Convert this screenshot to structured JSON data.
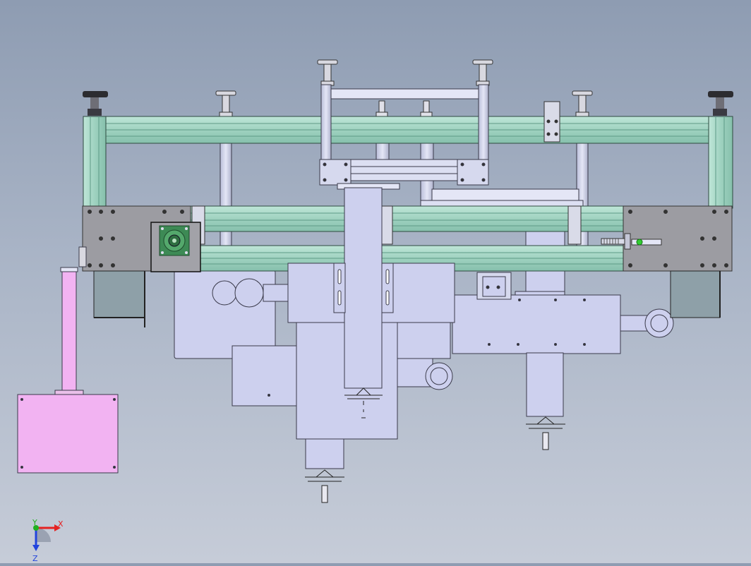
{
  "viewport": {
    "background_top": "#8e9cb2",
    "background_bottom": "#c6ccd8"
  },
  "colors": {
    "extrusion": "#a8d8c8",
    "extrusion_dark": "#6fae98",
    "steel_plate": "#9a9aa0",
    "part_fill": "#cdd0ee",
    "part_stroke": "#3a3a4a",
    "motor_block": "#8ea0a8",
    "pink_part": "#f2b3f2",
    "bearing_green": "#3d8a55"
  },
  "triad": {
    "x_label": "X",
    "y_label": "Y",
    "z_label": "Z",
    "x_color": "#e52222",
    "y_color": "#1fb01f",
    "z_color": "#2244dd"
  }
}
